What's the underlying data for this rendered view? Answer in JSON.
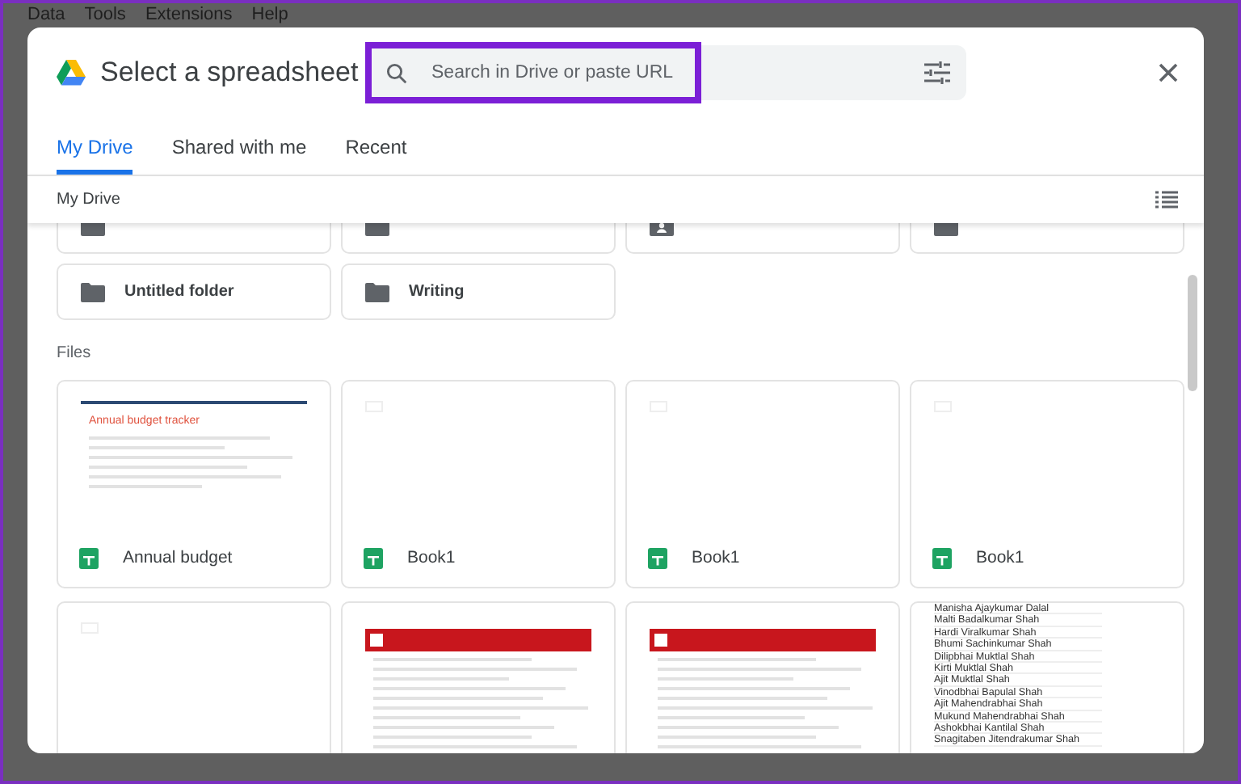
{
  "background_menu": [
    "Data",
    "Tools",
    "Extensions",
    "Help"
  ],
  "dialog": {
    "title": "Select a spreadsheet",
    "search": {
      "placeholder": "Search in Drive or paste URL",
      "highlighted": true
    },
    "tabs": [
      {
        "label": "My Drive",
        "selected": true
      },
      {
        "label": "Shared with me",
        "selected": false
      },
      {
        "label": "Recent",
        "selected": false
      }
    ],
    "breadcrumb": "My Drive",
    "folders_partial": [
      {
        "kind": "folder"
      },
      {
        "kind": "folder"
      },
      {
        "kind": "shared_folder"
      },
      {
        "kind": "folder"
      }
    ],
    "folders": [
      "Untitled folder",
      "Writing"
    ],
    "files_label": "Files",
    "files": [
      {
        "name": "Annual budget",
        "thumbnail": {
          "kind": "budget",
          "title": "Annual budget tracker"
        }
      },
      {
        "name": "Book1",
        "thumbnail": {
          "kind": "blank"
        }
      },
      {
        "name": "Book1",
        "thumbnail": {
          "kind": "blank"
        }
      },
      {
        "name": "Book1",
        "thumbnail": {
          "kind": "blank"
        }
      }
    ],
    "files_partial": [
      {
        "kind": "blank"
      },
      {
        "kind": "report"
      },
      {
        "kind": "report"
      },
      {
        "kind": "names",
        "lines": [
          "Manisha Ajaykumar Dalal",
          "Malti Badalkumar Shah",
          "Hardi Viralkumar Shah",
          "Bhumi Sachinkumar Shah",
          "Dilipbhai Muktlal Shah",
          "Kirti Muktlal Shah",
          "Ajit Muktlal Shah",
          "Vinodbhai Bapulal Shah",
          "Ajit Mahendrabhai Shah",
          "Mukund Mahendrabhai Shah",
          "Ashokbhai Kantilal Shah",
          "Snagitaben Jitendrakumar Shah"
        ]
      }
    ]
  }
}
